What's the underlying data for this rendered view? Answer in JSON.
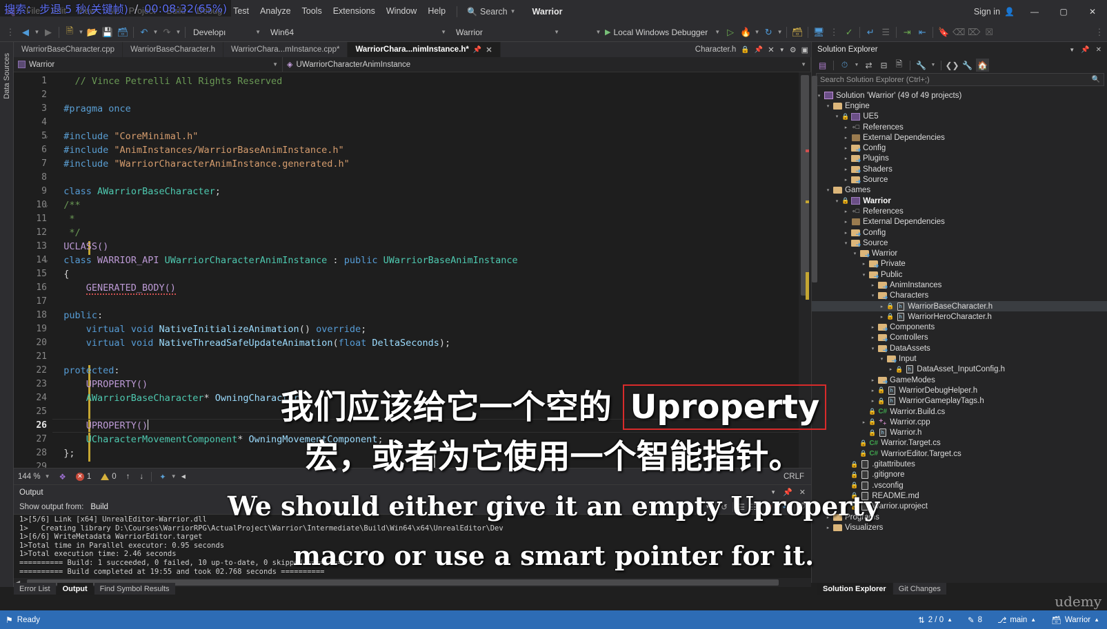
{
  "overlay_seek": {
    "label": "搜索：",
    "action": "步退 5 秒(关键帧)",
    "separator": "/",
    "time": "00:08:32(65%)"
  },
  "menubar": {
    "items": [
      "File",
      "Edit",
      "View",
      "Git",
      "Project",
      "Build",
      "Debug",
      "Test",
      "Analyze",
      "Tools",
      "Extensions",
      "Window",
      "Help"
    ],
    "search_placeholder": "Search",
    "project_title": "Warrior",
    "sign_in": "Sign in",
    "window_minimize": "—",
    "window_restore": "▢",
    "window_close": "✕"
  },
  "toolbar": {
    "config": "Developı",
    "platform": "Win64",
    "startup_project": "Warrior",
    "debug_target": "Local Windows Debugger"
  },
  "editor": {
    "tabs": [
      {
        "label": "WarriorBaseCharacter.cpp",
        "active": false
      },
      {
        "label": "WarriorBaseCharacter.h",
        "active": false
      },
      {
        "label": "WarriorChara...mInstance.cpp*",
        "active": false
      },
      {
        "label": "WarriorChara...nimInstance.h*",
        "active": true
      }
    ],
    "tab_right": {
      "doc": "Character.h",
      "lock": "🔒"
    },
    "nav_project": "Warrior",
    "nav_symbol": "UWarriorCharacterAnimInstance",
    "zoom": "144 %",
    "error_count": "1",
    "warning_count": "0",
    "line_ending": "CRLF",
    "current_line": 26,
    "code_lines": [
      {
        "n": 1,
        "tokens": [
          {
            "t": "    ",
            "c": "plain"
          },
          {
            "t": "// Vince Petrelli All Rights Reserved",
            "c": "com"
          }
        ]
      },
      {
        "n": 2,
        "tokens": []
      },
      {
        "n": 3,
        "tokens": [
          {
            "t": "  ",
            "c": "plain"
          },
          {
            "t": "#pragma once",
            "c": "pre"
          }
        ]
      },
      {
        "n": 4,
        "tokens": []
      },
      {
        "n": 5,
        "tokens": [
          {
            "t": "  ",
            "c": "plain"
          },
          {
            "t": "#include ",
            "c": "pre"
          },
          {
            "t": "\"CoreMinimal.h\"",
            "c": "str"
          }
        ]
      },
      {
        "n": 6,
        "tokens": [
          {
            "t": "  ",
            "c": "plain"
          },
          {
            "t": "#include ",
            "c": "pre"
          },
          {
            "t": "\"AnimInstances/WarriorBaseAnimInstance.h\"",
            "c": "str"
          }
        ]
      },
      {
        "n": 7,
        "tokens": [
          {
            "t": "  ",
            "c": "plain"
          },
          {
            "t": "#include ",
            "c": "pre"
          },
          {
            "t": "\"WarriorCharacterAnimInstance.generated.h\"",
            "c": "str"
          }
        ]
      },
      {
        "n": 8,
        "tokens": []
      },
      {
        "n": 9,
        "tokens": [
          {
            "t": "  ",
            "c": "plain"
          },
          {
            "t": "class",
            "c": "key"
          },
          {
            "t": " ",
            "c": "plain"
          },
          {
            "t": "AWarriorBaseCharacter",
            "c": "type"
          },
          {
            "t": ";",
            "c": "plain"
          }
        ]
      },
      {
        "n": 10,
        "tokens": [
          {
            "t": "  ",
            "c": "plain"
          },
          {
            "t": "/**",
            "c": "com"
          }
        ]
      },
      {
        "n": 11,
        "tokens": [
          {
            "t": "   ",
            "c": "plain"
          },
          {
            "t": "*",
            "c": "com"
          }
        ]
      },
      {
        "n": 12,
        "tokens": [
          {
            "t": "   ",
            "c": "plain"
          },
          {
            "t": "*/",
            "c": "com"
          }
        ]
      },
      {
        "n": 13,
        "tokens": [
          {
            "t": "  ",
            "c": "plain"
          },
          {
            "t": "UCLASS()",
            "c": "mac"
          }
        ]
      },
      {
        "n": 14,
        "tokens": [
          {
            "t": "  ",
            "c": "plain"
          },
          {
            "t": "class",
            "c": "key"
          },
          {
            "t": " ",
            "c": "plain"
          },
          {
            "t": "WARRIOR_API",
            "c": "mac"
          },
          {
            "t": " ",
            "c": "plain"
          },
          {
            "t": "UWarriorCharacterAnimInstance",
            "c": "type"
          },
          {
            "t": " : ",
            "c": "plain"
          },
          {
            "t": "public",
            "c": "key"
          },
          {
            "t": " ",
            "c": "plain"
          },
          {
            "t": "UWarriorBaseAnimInstance",
            "c": "type"
          }
        ]
      },
      {
        "n": 15,
        "tokens": [
          {
            "t": "  {",
            "c": "plain"
          }
        ]
      },
      {
        "n": 16,
        "tokens": [
          {
            "t": "      ",
            "c": "plain"
          },
          {
            "t": "GENERATED_BODY()",
            "c": "mac"
          }
        ]
      },
      {
        "n": 17,
        "tokens": []
      },
      {
        "n": 18,
        "tokens": [
          {
            "t": "  ",
            "c": "plain"
          },
          {
            "t": "public",
            "c": "key"
          },
          {
            "t": ":",
            "c": "plain"
          }
        ]
      },
      {
        "n": 19,
        "tokens": [
          {
            "t": "      ",
            "c": "plain"
          },
          {
            "t": "virtual",
            "c": "key"
          },
          {
            "t": " ",
            "c": "plain"
          },
          {
            "t": "void",
            "c": "key"
          },
          {
            "t": " ",
            "c": "plain"
          },
          {
            "t": "NativeInitializeAnimation",
            "c": "var"
          },
          {
            "t": "() ",
            "c": "plain"
          },
          {
            "t": "override",
            "c": "key"
          },
          {
            "t": ";",
            "c": "plain"
          }
        ]
      },
      {
        "n": 20,
        "tokens": [
          {
            "t": "      ",
            "c": "plain"
          },
          {
            "t": "virtual",
            "c": "key"
          },
          {
            "t": " ",
            "c": "plain"
          },
          {
            "t": "void",
            "c": "key"
          },
          {
            "t": " ",
            "c": "plain"
          },
          {
            "t": "NativeThreadSafeUpdateAnimation",
            "c": "var"
          },
          {
            "t": "(",
            "c": "plain"
          },
          {
            "t": "float",
            "c": "key"
          },
          {
            "t": " ",
            "c": "plain"
          },
          {
            "t": "DeltaSeconds",
            "c": "var"
          },
          {
            "t": ");",
            "c": "plain"
          }
        ]
      },
      {
        "n": 21,
        "tokens": []
      },
      {
        "n": 22,
        "tokens": [
          {
            "t": "  ",
            "c": "plain"
          },
          {
            "t": "protected",
            "c": "key"
          },
          {
            "t": ":",
            "c": "plain"
          }
        ]
      },
      {
        "n": 23,
        "tokens": [
          {
            "t": "      ",
            "c": "plain"
          },
          {
            "t": "UPROPERTY()",
            "c": "mac"
          }
        ]
      },
      {
        "n": 24,
        "tokens": [
          {
            "t": "      ",
            "c": "plain"
          },
          {
            "t": "AWarriorBaseCharacter",
            "c": "type"
          },
          {
            "t": "* ",
            "c": "plain"
          },
          {
            "t": "OwningCharacter",
            "c": "var"
          },
          {
            "t": ";",
            "c": "plain"
          }
        ]
      },
      {
        "n": 25,
        "tokens": []
      },
      {
        "n": 26,
        "tokens": [
          {
            "t": "      ",
            "c": "plain"
          },
          {
            "t": "UPROPERTY()",
            "c": "mac"
          }
        ]
      },
      {
        "n": 27,
        "tokens": [
          {
            "t": "      ",
            "c": "plain"
          },
          {
            "t": "UCharacterMovementComponent",
            "c": "type"
          },
          {
            "t": "* ",
            "c": "plain"
          },
          {
            "t": "OwningMovementComponent",
            "c": "var"
          },
          {
            "t": ";",
            "c": "plain"
          }
        ]
      },
      {
        "n": 28,
        "tokens": [
          {
            "t": "  };",
            "c": "plain"
          }
        ]
      },
      {
        "n": 29,
        "tokens": []
      }
    ]
  },
  "output": {
    "title": "Output",
    "show_output_from_label": "Show output from:",
    "show_output_from_value": "Build",
    "lines": [
      "1>[5/6] Link [x64] UnrealEditor-Warrior.dll",
      "1>   Creating library D:\\Courses\\WarriorRPG\\ActualProject\\Warrior\\Intermediate\\Build\\Win64\\x64\\UnrealEditor\\Dev",
      "1>[6/6] WriteMetadata WarriorEditor.target",
      "1>Total time in Parallel executor: 0.95 seconds",
      "1>Total execution time: 2.46 seconds",
      "========== Build: 1 succeeded, 0 failed, 10 up-to-date, 0 skipped ==========",
      "========== Build completed at 19:55 and took 02.768 seconds =========="
    ]
  },
  "bottom_tabs": {
    "left": [
      {
        "label": "Error List",
        "active": false
      },
      {
        "label": "Output",
        "active": true
      },
      {
        "label": "Find Symbol Results",
        "active": false
      }
    ],
    "right": [
      {
        "label": "Solution Explorer",
        "active": true
      },
      {
        "label": "Git Changes",
        "active": false
      }
    ]
  },
  "solution_explorer": {
    "title": "Solution Explorer",
    "search_placeholder": "Search Solution Explorer (Ctrl+;)",
    "tree": [
      {
        "indent": 0,
        "arrow": "down",
        "icon": "solution",
        "label": "Solution 'Warrior' (49 of 49 projects)",
        "bold": false,
        "lock": false,
        "sel": false
      },
      {
        "indent": 1,
        "arrow": "down",
        "icon": "folder",
        "label": "Engine",
        "bold": false,
        "lock": false,
        "sel": false
      },
      {
        "indent": 2,
        "arrow": "down",
        "icon": "project",
        "label": "UE5",
        "bold": false,
        "lock": true,
        "sel": false
      },
      {
        "indent": 3,
        "arrow": "right",
        "icon": "refs",
        "label": "References",
        "bold": false,
        "lock": false,
        "sel": false
      },
      {
        "indent": 3,
        "arrow": "right",
        "icon": "deps",
        "label": "External Dependencies",
        "bold": false,
        "lock": false,
        "sel": false
      },
      {
        "indent": 3,
        "arrow": "right",
        "icon": "folderb",
        "label": "Config",
        "bold": false,
        "lock": false,
        "sel": false
      },
      {
        "indent": 3,
        "arrow": "right",
        "icon": "folderb",
        "label": "Plugins",
        "bold": false,
        "lock": false,
        "sel": false
      },
      {
        "indent": 3,
        "arrow": "right",
        "icon": "folderb",
        "label": "Shaders",
        "bold": false,
        "lock": false,
        "sel": false
      },
      {
        "indent": 3,
        "arrow": "right",
        "icon": "folderb",
        "label": "Source",
        "bold": false,
        "lock": false,
        "sel": false
      },
      {
        "indent": 1,
        "arrow": "down",
        "icon": "folder",
        "label": "Games",
        "bold": false,
        "lock": false,
        "sel": false
      },
      {
        "indent": 2,
        "arrow": "down",
        "icon": "project",
        "label": "Warrior",
        "bold": true,
        "lock": true,
        "sel": false
      },
      {
        "indent": 3,
        "arrow": "right",
        "icon": "refs",
        "label": "References",
        "bold": false,
        "lock": false,
        "sel": false
      },
      {
        "indent": 3,
        "arrow": "right",
        "icon": "deps",
        "label": "External Dependencies",
        "bold": false,
        "lock": false,
        "sel": false
      },
      {
        "indent": 3,
        "arrow": "right",
        "icon": "folderb",
        "label": "Config",
        "bold": false,
        "lock": false,
        "sel": false
      },
      {
        "indent": 3,
        "arrow": "down",
        "icon": "folderb",
        "label": "Source",
        "bold": false,
        "lock": false,
        "sel": false
      },
      {
        "indent": 4,
        "arrow": "down",
        "icon": "folderb",
        "label": "Warrior",
        "bold": false,
        "lock": false,
        "sel": false
      },
      {
        "indent": 5,
        "arrow": "right",
        "icon": "folderb",
        "label": "Private",
        "bold": false,
        "lock": false,
        "sel": false
      },
      {
        "indent": 5,
        "arrow": "down",
        "icon": "folderb",
        "label": "Public",
        "bold": false,
        "lock": false,
        "sel": false
      },
      {
        "indent": 6,
        "arrow": "right",
        "icon": "folderb",
        "label": "AnimInstances",
        "bold": false,
        "lock": false,
        "sel": false
      },
      {
        "indent": 6,
        "arrow": "down",
        "icon": "folderb",
        "label": "Characters",
        "bold": false,
        "lock": false,
        "sel": false
      },
      {
        "indent": 7,
        "arrow": "right",
        "icon": "hfile",
        "label": "WarriorBaseCharacter.h",
        "bold": false,
        "lock": true,
        "sel": true
      },
      {
        "indent": 7,
        "arrow": "right",
        "icon": "hfile",
        "label": "WarriorHeroCharacter.h",
        "bold": false,
        "lock": true,
        "sel": false
      },
      {
        "indent": 6,
        "arrow": "right",
        "icon": "folderb",
        "label": "Components",
        "bold": false,
        "lock": false,
        "sel": false
      },
      {
        "indent": 6,
        "arrow": "right",
        "icon": "folderb",
        "label": "Controllers",
        "bold": false,
        "lock": false,
        "sel": false
      },
      {
        "indent": 6,
        "arrow": "down",
        "icon": "folderb",
        "label": "DataAssets",
        "bold": false,
        "lock": false,
        "sel": false
      },
      {
        "indent": 7,
        "arrow": "down",
        "icon": "folderb",
        "label": "Input",
        "bold": false,
        "lock": false,
        "sel": false
      },
      {
        "indent": 8,
        "arrow": "right",
        "icon": "hfile",
        "label": "DataAsset_InputConfig.h",
        "bold": false,
        "lock": true,
        "sel": false
      },
      {
        "indent": 6,
        "arrow": "right",
        "icon": "folderb",
        "label": "GameModes",
        "bold": false,
        "lock": false,
        "sel": false
      },
      {
        "indent": 6,
        "arrow": "right",
        "icon": "hfile",
        "label": "WarriorDebugHelper.h",
        "bold": false,
        "lock": true,
        "sel": false
      },
      {
        "indent": 6,
        "arrow": "right",
        "icon": "hfile",
        "label": "WarriorGameplayTags.h",
        "bold": false,
        "lock": true,
        "sel": false
      },
      {
        "indent": 5,
        "arrow": "none",
        "icon": "cs",
        "label": "Warrior.Build.cs",
        "bold": false,
        "lock": true,
        "sel": false
      },
      {
        "indent": 5,
        "arrow": "right",
        "icon": "cpp",
        "label": "Warrior.cpp",
        "bold": false,
        "lock": true,
        "sel": false
      },
      {
        "indent": 5,
        "arrow": "none",
        "icon": "hfile",
        "label": "Warrior.h",
        "bold": false,
        "lock": true,
        "sel": false
      },
      {
        "indent": 4,
        "arrow": "none",
        "icon": "cs",
        "label": "Warrior.Target.cs",
        "bold": false,
        "lock": true,
        "sel": false
      },
      {
        "indent": 4,
        "arrow": "none",
        "icon": "cs",
        "label": "WarriorEditor.Target.cs",
        "bold": false,
        "lock": true,
        "sel": false
      },
      {
        "indent": 3,
        "arrow": "none",
        "icon": "txt",
        "label": ".gitattributes",
        "bold": false,
        "lock": true,
        "sel": false
      },
      {
        "indent": 3,
        "arrow": "none",
        "icon": "txt",
        "label": ".gitignore",
        "bold": false,
        "lock": true,
        "sel": false
      },
      {
        "indent": 3,
        "arrow": "none",
        "icon": "txt",
        "label": ".vsconfig",
        "bold": false,
        "lock": true,
        "sel": false
      },
      {
        "indent": 3,
        "arrow": "none",
        "icon": "md",
        "label": "README.md",
        "bold": false,
        "lock": true,
        "sel": false
      },
      {
        "indent": 3,
        "arrow": "none",
        "icon": "txt",
        "label": "Warrior.uproject",
        "bold": false,
        "lock": true,
        "sel": false
      },
      {
        "indent": 1,
        "arrow": "right",
        "icon": "folder",
        "label": "Programs",
        "bold": false,
        "lock": false,
        "sel": false
      },
      {
        "indent": 1,
        "arrow": "right",
        "icon": "folder",
        "label": "Visualizers",
        "bold": false,
        "lock": false,
        "sel": false
      }
    ]
  },
  "statusbar": {
    "ready": "Ready",
    "changes": "2 / 0",
    "line_col": "8",
    "branch": "main",
    "repo": "Warrior"
  },
  "subtitles": {
    "cn_line1_a": "我们应该给它一个空的 ",
    "cn_line1_hl": "Uproperty",
    "cn_line2": "宏，或者为它使用一个智能指针。",
    "en_line1": "We should either give it an empty Uproperty",
    "en_line2": "macro or use a smart pointer for it."
  },
  "watermark": "udemy",
  "colors": {
    "accent": "#2d6cb5",
    "highlight_box": "#d92b2b",
    "tab_active_bg": "#1e1e1e",
    "chrome_bg": "#2d2d30",
    "editor_bg": "#1e1e1e",
    "overlay_text": "#5b6cf0"
  }
}
